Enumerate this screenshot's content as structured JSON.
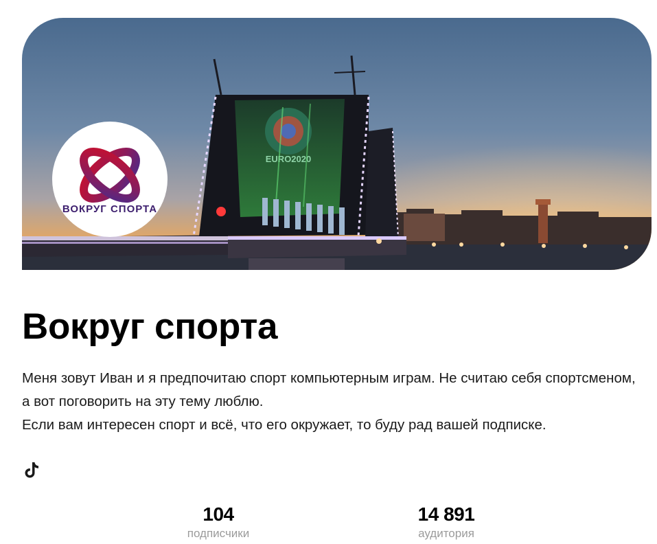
{
  "cover": {
    "banner_text": "EURO2020"
  },
  "avatar": {
    "logo_text": "ВОКРУГ СПОРТА"
  },
  "channel": {
    "title": "Вокруг спорта",
    "description_line1": "Меня зовут Иван и я предпочитаю спорт компьютерным играм. Не считаю себя спортсменом, а вот поговорить на эту тему люблю.",
    "description_line2": "Если вам интересен спорт и всё, что его окружает, то буду рад вашей подписке."
  },
  "social": {
    "icon": "tiktok-icon"
  },
  "stats": {
    "subscribers_value": "104",
    "subscribers_label": "подписчики",
    "audience_value": "14 891",
    "audience_label": "аудитория"
  },
  "colors": {
    "logo_red": "#c8102e",
    "logo_purple": "#4b2a8a",
    "sky_top": "#3b5f8c",
    "sky_bottom": "#e7a35d",
    "label_grey": "#9b9b9b"
  }
}
